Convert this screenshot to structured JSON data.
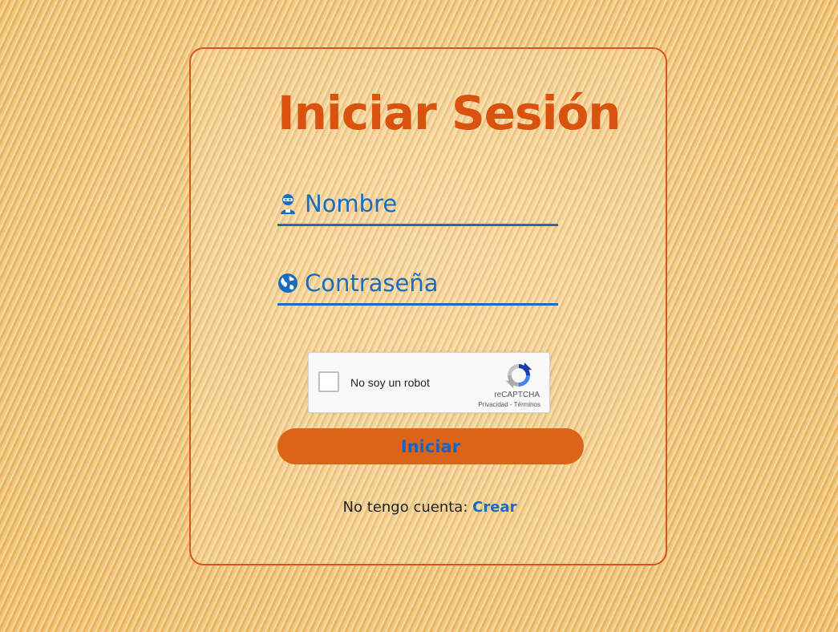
{
  "login": {
    "title": "Iniciar Sesión",
    "username_placeholder": "Nombre",
    "username_value": "",
    "password_placeholder": "Contraseña",
    "password_value": "",
    "submit_label": "Iniciar",
    "no_account_text": "No tengo cuenta:",
    "create_link_label": "Crear"
  },
  "recaptcha": {
    "checkbox_label": "No soy un robot",
    "brand": "reCAPTCHA",
    "privacy_label": "Privacidad",
    "separator": "-",
    "terms_label": "Términos",
    "checked": false
  },
  "icons": {
    "username": "user-robot-icon",
    "password": "globe-icon",
    "captcha": "recaptcha-logo-icon"
  },
  "colors": {
    "accent_orange": "#d9530f",
    "button_orange": "#dc6418",
    "field_blue": "#1a6dbd",
    "background": "#ecc27e"
  }
}
